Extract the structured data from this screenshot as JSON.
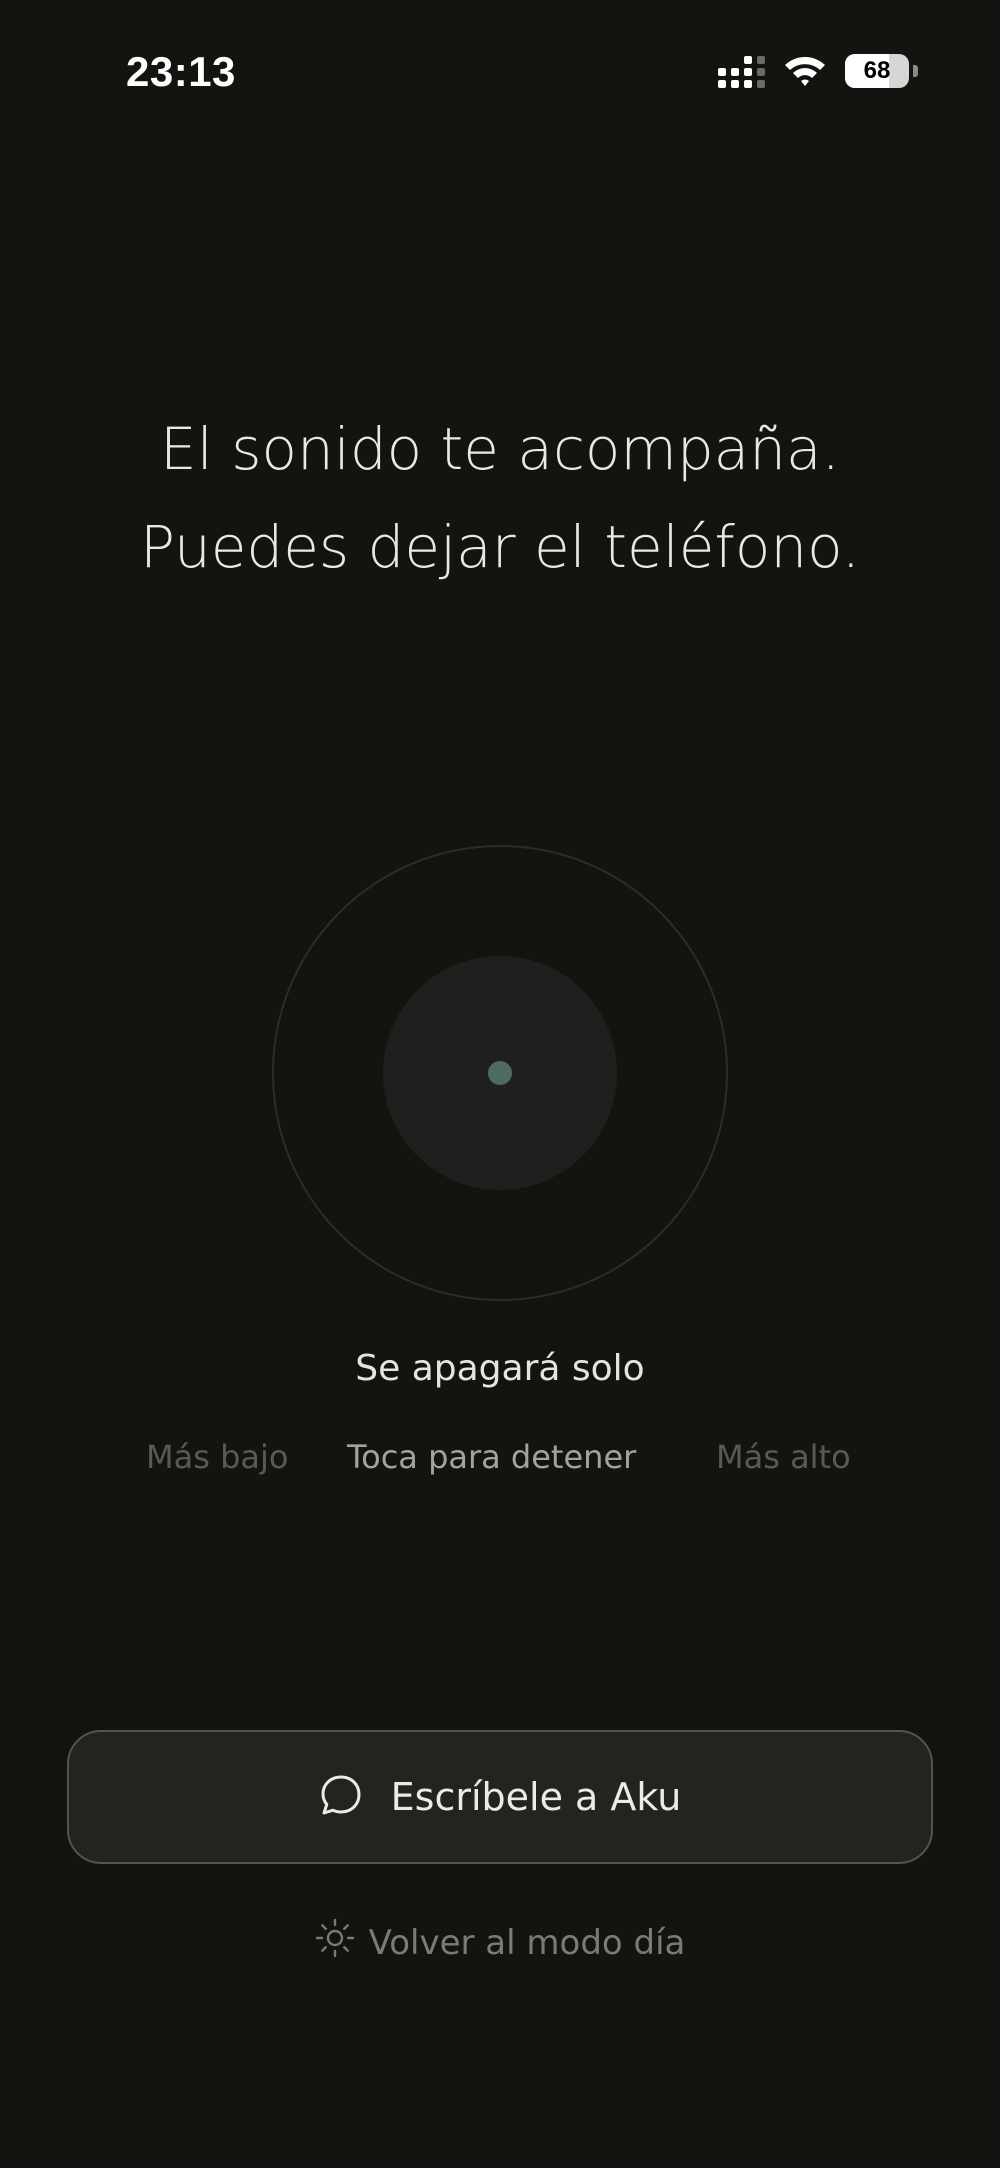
{
  "status_bar": {
    "time": "23:13",
    "battery": "68",
    "battery_level": 0.68,
    "signal_icon": "cellular-signal-icon",
    "wifi_icon": "wifi-icon"
  },
  "message": {
    "line1": "El sonido te acompaña.",
    "line2": "Puedes dejar el teléfono."
  },
  "player": {
    "auto_off_label": "Se apagará solo",
    "lower_label": "Más bajo",
    "stop_label": "Toca para detener",
    "higher_label": "Más alto",
    "orb_icon": "sound-orb-icon"
  },
  "actions": {
    "write_label": "Escríbele a Aku",
    "write_icon": "chat-bubble-icon",
    "day_mode_label": "Volver al modo día",
    "day_mode_icon": "sun-icon"
  },
  "colors": {
    "background": "#141310",
    "orb_dot": "#4f6a62"
  }
}
